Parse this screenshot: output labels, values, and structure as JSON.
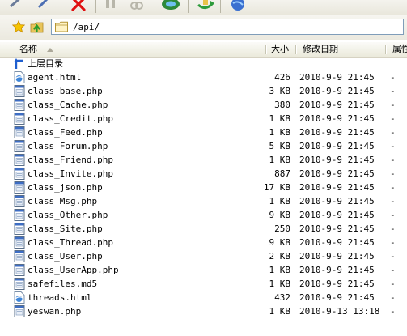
{
  "address": {
    "path": "/api/"
  },
  "columns": {
    "name": "名称",
    "size": "大小",
    "modified": "修改日期",
    "attributes": "属性"
  },
  "parent_dir_label": "上层目录",
  "files": [
    {
      "name": "agent.html",
      "size": "426",
      "modified": "2010-9-9 21:45",
      "attr": "-",
      "type": "html"
    },
    {
      "name": "class_base.php",
      "size": "3 KB",
      "modified": "2010-9-9 21:45",
      "attr": "-",
      "type": "file"
    },
    {
      "name": "class_Cache.php",
      "size": "380",
      "modified": "2010-9-9 21:45",
      "attr": "-",
      "type": "file"
    },
    {
      "name": "class_Credit.php",
      "size": "1 KB",
      "modified": "2010-9-9 21:45",
      "attr": "-",
      "type": "file"
    },
    {
      "name": "class_Feed.php",
      "size": "1 KB",
      "modified": "2010-9-9 21:45",
      "attr": "-",
      "type": "file"
    },
    {
      "name": "class_Forum.php",
      "size": "5 KB",
      "modified": "2010-9-9 21:45",
      "attr": "-",
      "type": "file"
    },
    {
      "name": "class_Friend.php",
      "size": "1 KB",
      "modified": "2010-9-9 21:45",
      "attr": "-",
      "type": "file"
    },
    {
      "name": "class_Invite.php",
      "size": "887",
      "modified": "2010-9-9 21:45",
      "attr": "-",
      "type": "file"
    },
    {
      "name": "class_json.php",
      "size": "17 KB",
      "modified": "2010-9-9 21:45",
      "attr": "-",
      "type": "file"
    },
    {
      "name": "class_Msg.php",
      "size": "1 KB",
      "modified": "2010-9-9 21:45",
      "attr": "-",
      "type": "file"
    },
    {
      "name": "class_Other.php",
      "size": "9 KB",
      "modified": "2010-9-9 21:45",
      "attr": "-",
      "type": "file"
    },
    {
      "name": "class_Site.php",
      "size": "250",
      "modified": "2010-9-9 21:45",
      "attr": "-",
      "type": "file"
    },
    {
      "name": "class_Thread.php",
      "size": "9 KB",
      "modified": "2010-9-9 21:45",
      "attr": "-",
      "type": "file"
    },
    {
      "name": "class_User.php",
      "size": "2 KB",
      "modified": "2010-9-9 21:45",
      "attr": "-",
      "type": "file"
    },
    {
      "name": "class_UserApp.php",
      "size": "1 KB",
      "modified": "2010-9-9 21:45",
      "attr": "-",
      "type": "file"
    },
    {
      "name": "safefiles.md5",
      "size": "1 KB",
      "modified": "2010-9-9 21:45",
      "attr": "-",
      "type": "file"
    },
    {
      "name": "threads.html",
      "size": "432",
      "modified": "2010-9-9 21:45",
      "attr": "-",
      "type": "html"
    },
    {
      "name": "yeswan.php",
      "size": "1 KB",
      "modified": "2010-9-13 13:18",
      "attr": "-",
      "type": "file"
    }
  ],
  "icons": {
    "toolbar": [
      "connect-icon",
      "wand-icon",
      "pause-icon",
      "link-icon",
      "delete-icon",
      "refresh-icon",
      "sync-icon",
      "globe-icon"
    ],
    "html_file": "ie-file-icon",
    "generic_file": "generic-file-icon",
    "parent": "up-arrow-icon"
  },
  "colors": {
    "address_border": "#7f9db9",
    "header_bg": "#ebeadb",
    "delete_red": "#e01010"
  }
}
